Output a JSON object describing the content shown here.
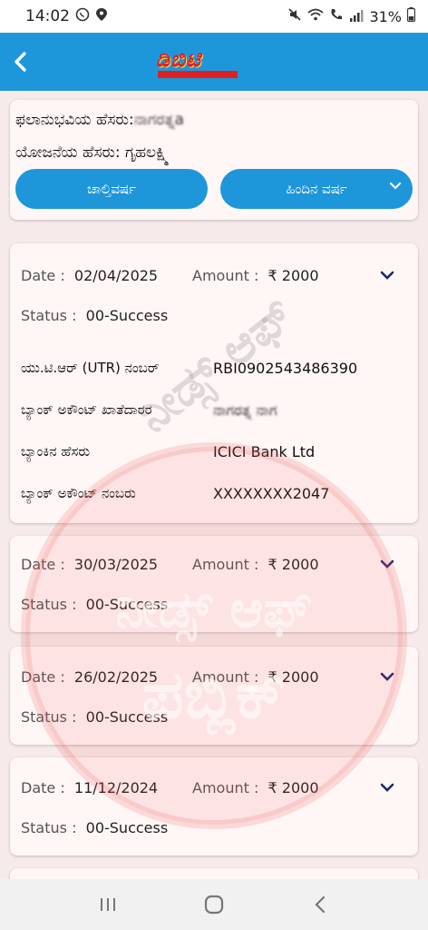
{
  "status_bar": {
    "time": "14:02",
    "battery": "31%",
    "left_icons": [
      "whatsapp-icon",
      "location-icon"
    ],
    "right_icons": [
      "mute-icon",
      "wifi-icon",
      "call-icon",
      "signal-icon",
      "battery-icon"
    ]
  },
  "app_bar": {
    "logo_text": "ಡಿಬಿಟಿ",
    "back_icon": "back-chevron-icon"
  },
  "beneficiary": {
    "name_label": "ಫಲಾನುಭವಿಯ ಹೆಸರು:",
    "name_value": "ನಾಗರತ್ನa",
    "scheme_label": "ಯೋಜನೆಯ ಹೆಸರು: ಗೃಹಲಕ್ಷ್ಮಿ",
    "current_year_button": "ಚಾಲ್ತಿವರ್ಷ",
    "previous_year_button": "ಹಿಂದಿನ ವರ್ಷ"
  },
  "payments": [
    {
      "date_label": "Date :",
      "date": "02/04/2025",
      "amount_label": "Amount :",
      "amount": "₹ 2000",
      "status_label": "Status :",
      "status": "00-Success",
      "expanded": true,
      "details": [
        {
          "label": "ಯು.ಟಿ.ಆರ್ (UTR) ನಂಬರ್",
          "value": "RBI0902543486390"
        },
        {
          "label": "ಬ್ಯಾಂಕ್ ಅಕೌಂಟ್ ಖಾತೆದಾರರ",
          "value": "ನಾಗರತ್ನ ನಾಗ"
        },
        {
          "label": "ಬ್ಯಾಂಕಿನ ಹೆಸರು",
          "value": "ICICI Bank Ltd"
        },
        {
          "label": "ಬ್ಯಾಂಕ್ ಅಕೌಂಟ್ ನಂಬರು",
          "value": "XXXXXXXX2047"
        }
      ]
    },
    {
      "date_label": "Date :",
      "date": "30/03/2025",
      "amount_label": "Amount :",
      "amount": "₹ 2000",
      "status_label": "Status :",
      "status": "00-Success",
      "expanded": false
    },
    {
      "date_label": "Date :",
      "date": "26/02/2025",
      "amount_label": "Amount :",
      "amount": "₹ 2000",
      "status_label": "Status :",
      "status": "00-Success",
      "expanded": false
    },
    {
      "date_label": "Date :",
      "date": "11/12/2024",
      "amount_label": "Amount :",
      "amount": "₹ 2000",
      "status_label": "Status :",
      "status": "00-Success",
      "expanded": false
    }
  ],
  "watermark": {
    "text_line1": "ನೀಡ್ಸ್ ಆಫ್",
    "text_line2": "ಪಬ್ಲಿಕ್"
  },
  "nav_bar": {
    "icons": [
      "recents-icon",
      "home-icon",
      "back-icon"
    ]
  },
  "colors": {
    "primary": "#1e96da",
    "background": "#f6eaea",
    "card": "#fff6f6",
    "chevron": "#1a2a6c"
  }
}
